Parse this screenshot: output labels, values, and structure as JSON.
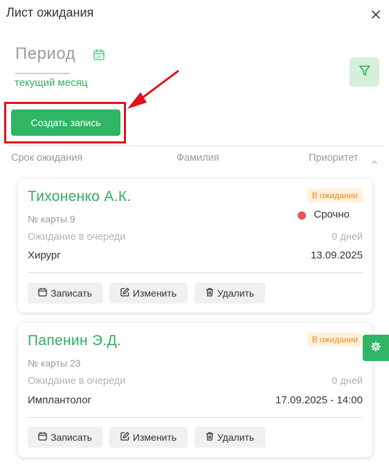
{
  "window": {
    "title": "Лист ожидания"
  },
  "period": {
    "label": "Период",
    "value": "текущий месяц"
  },
  "actions": {
    "create_label": "Создать запись"
  },
  "columns": {
    "term": "Срок ожидания",
    "name": "Фамилия",
    "priority": "Приоритет"
  },
  "cards": [
    {
      "name": "Тихоненко А.К.",
      "status": "В ожидании",
      "priority": "Срочно",
      "card_no": "№ карты 9",
      "wait_label": "Ожидание в очереди",
      "wait_value": "0 дней",
      "specialty": "Хирург",
      "date": "13.09.2025",
      "buttons": {
        "book": "Записать",
        "edit": "Изменить",
        "delete": "Удалить"
      }
    },
    {
      "name": "Папенин Э.Д.",
      "status": "В ожидании",
      "card_no": "№ карты 23",
      "wait_label": "Ожидание в очереди",
      "wait_value": "0 дней",
      "specialty": "Имплантолог",
      "date": "17.09.2025 - 14:00",
      "buttons": {
        "book": "Записать",
        "edit": "Изменить",
        "delete": "Удалить"
      }
    }
  ],
  "colors": {
    "accent": "#2fb564",
    "accent_text": "#2fae5c",
    "status_bg": "#fff1dd",
    "status_text": "#ef8a17",
    "urgent_dot": "#e85757",
    "annotation": "#e0121b"
  },
  "icons": [
    "close-icon",
    "calendar-icon",
    "filter-icon",
    "sort-arrow-icon",
    "calendar-icon",
    "edit-icon",
    "trash-icon",
    "gear-icon"
  ]
}
